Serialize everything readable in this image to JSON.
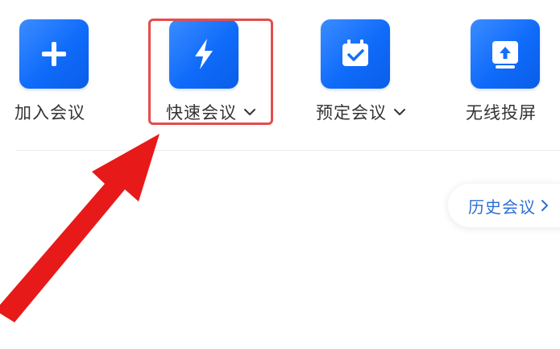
{
  "actions": [
    {
      "label": "加入会议",
      "icon": "plus-icon",
      "has_dropdown": false
    },
    {
      "label": "快速会议",
      "icon": "lightning-icon",
      "has_dropdown": true
    },
    {
      "label": "预定会议",
      "icon": "calendar-check-icon",
      "has_dropdown": true
    },
    {
      "label": "无线投屏",
      "icon": "screen-cast-icon",
      "has_dropdown": false
    }
  ],
  "history": {
    "label": "历史会议",
    "icon": "chevron-right-icon"
  },
  "colors": {
    "tile_blue": "#0f6bfa",
    "history_text": "#2f6fd6",
    "annotation_red": "#e74c4c",
    "arrow_red": "#e81919"
  },
  "annotation": {
    "highlighted_action": "快速会议",
    "arrow": "red-arrow-pointing-to-quick-meeting"
  }
}
